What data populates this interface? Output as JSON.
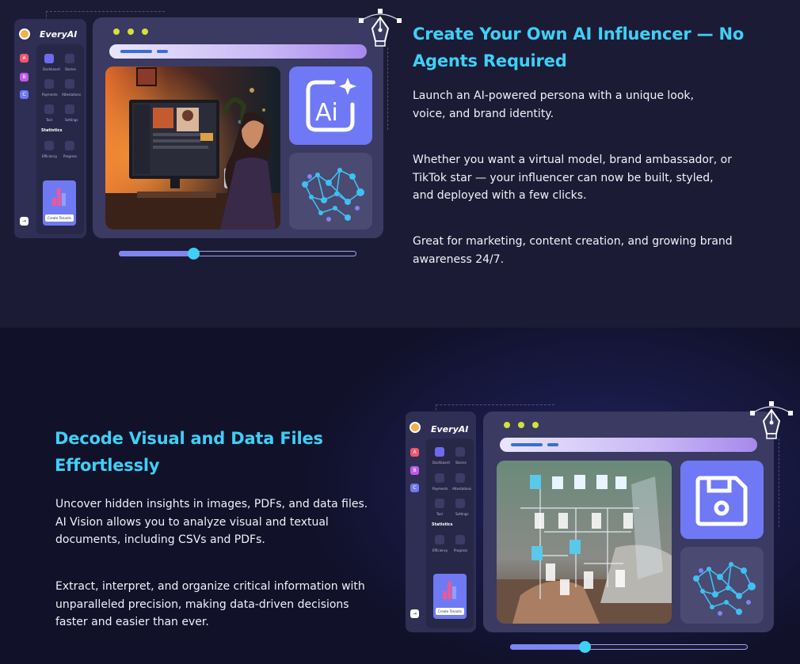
{
  "colors": {
    "accent_heading": "#3ed0f5",
    "section1_bg": "#1b1b36",
    "section2_bg": "#11112a",
    "window_bg": "#3a3a62",
    "tile_primary": "#6f79f5",
    "slider_knob": "#3ed0f5"
  },
  "section1": {
    "headline_line1": "Create Your Own AI Influencer — No",
    "headline_line2": "Agents Required",
    "paragraphs": [
      "Launch an AI-powered persona with a unique look,",
      "voice, and brand identity.",
      "Whether you want a virtual model, brand ambassador, or",
      "TikTok star — your influencer can now be built, styled,",
      "and deployed with a few clicks.",
      "Great for marketing, content creation, and growing brand",
      "awareness 24/7."
    ],
    "illustration": {
      "brand": "EveryAI",
      "sidebar_items": [
        "Dashboard",
        "Stories",
        "Payments",
        "Attestations",
        "Tool",
        "Settings"
      ],
      "statistics_label": "Statistics",
      "stat_items": [
        "Efficiency",
        "Progress"
      ],
      "cta_button": "Create Tenants",
      "tile_icon": "ai-sparkle-icon",
      "network_icon": "neural-network-icon",
      "slider_level": 0.3
    }
  },
  "section2": {
    "headline_line1": "Decode Visual and Data Files",
    "headline_line2": "Effortlessly",
    "paragraphs": [
      "Uncover hidden insights in images, PDFs, and data files.",
      "AI Vision allows you to analyze visual and textual",
      "documents, including CSVs and PDFs.",
      "Extract, interpret, and organize critical information with",
      "unparalleled precision, making data-driven decisions",
      "faster and easier than ever."
    ],
    "illustration": {
      "brand": "EveryAI",
      "sidebar_items": [
        "Dashboard",
        "Stories",
        "Payments",
        "Attestations",
        "Tool",
        "Settings"
      ],
      "statistics_label": "Statistics",
      "stat_items": [
        "Efficiency",
        "Progress"
      ],
      "cta_button": "Create Tenants",
      "tile_icon": "floppy-disk-icon",
      "network_icon": "neural-network-icon",
      "slider_level": 0.3
    }
  }
}
